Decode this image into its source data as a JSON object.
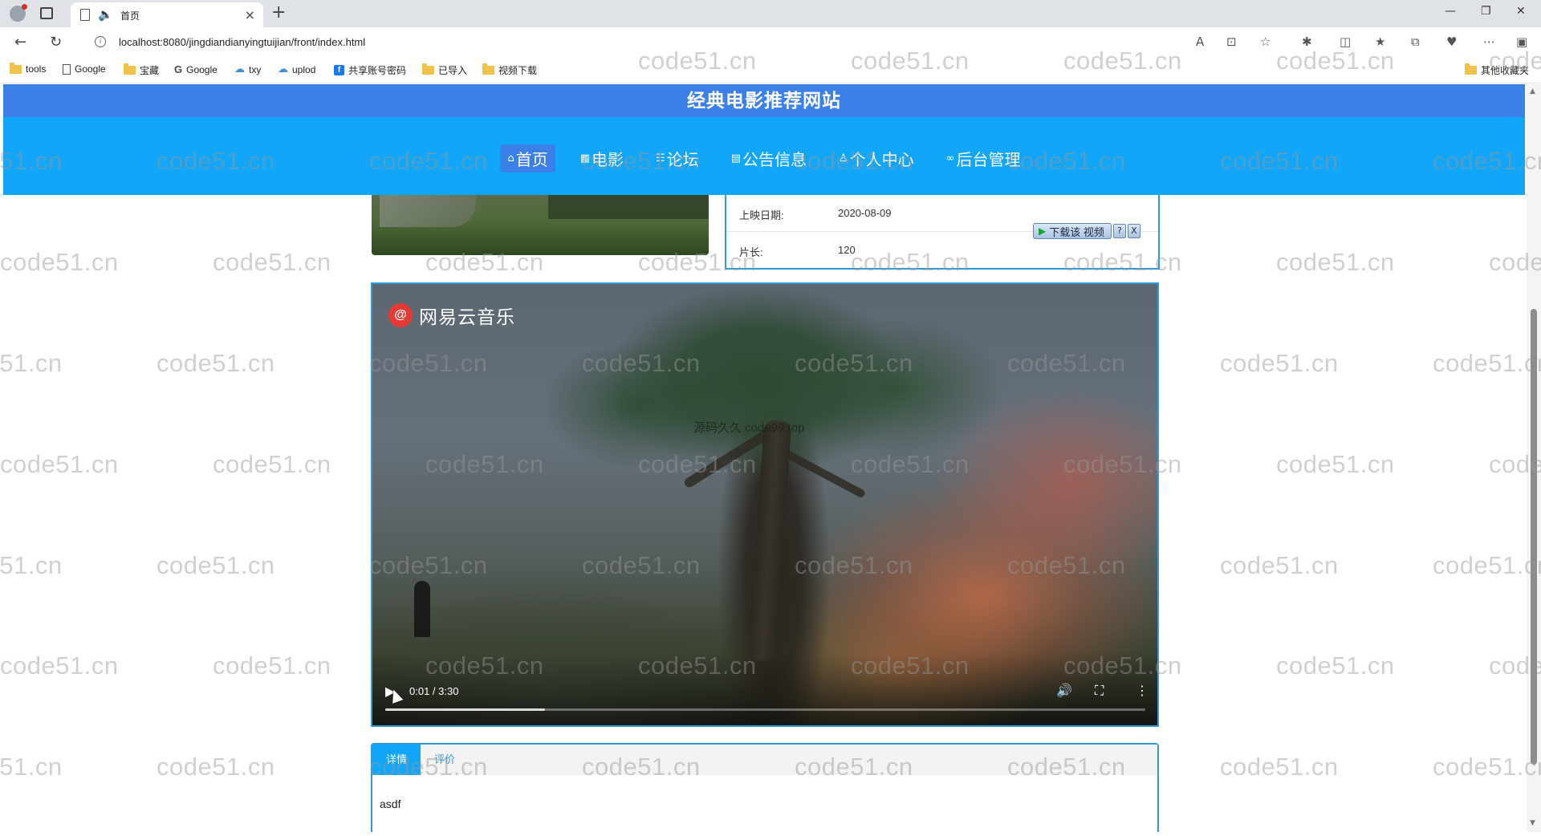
{
  "browser": {
    "tab_title": "首页",
    "url": "localhost:8080/jingdiandianyingtuijian/front/index.html",
    "bookmarks": [
      "tools",
      "Google",
      "宝藏",
      "Google",
      "txy",
      "uplod",
      "共享账号密码",
      "已导入",
      "视频下载"
    ],
    "other_bookmarks": "其他收藏夹"
  },
  "site": {
    "title": "经典电影推荐网站",
    "nav": [
      "首页",
      "电影",
      "论坛",
      "公告信息",
      "个人中心",
      "后台管理"
    ],
    "active_nav_index": 0
  },
  "movie": {
    "release_label": "上映日期:",
    "release_value": "2020-08-09",
    "length_label": "片长:",
    "length_value": "120"
  },
  "download_widget": {
    "label": "下载该 视频",
    "help": "?",
    "close": "X"
  },
  "video": {
    "logo_text": "网易云音乐",
    "overlay_text": "源码久久 code99.top",
    "time": "0:01 / 3:30",
    "buffered_fraction": 0.21
  },
  "tabs": {
    "items": [
      "详情",
      "评价"
    ],
    "active": 0,
    "content": "asdf"
  },
  "watermark": "code51.cn",
  "icons": {
    "nav": [
      "home-icon",
      "film-icon",
      "forum-icon",
      "notice-icon",
      "user-icon",
      "link-icon"
    ]
  }
}
